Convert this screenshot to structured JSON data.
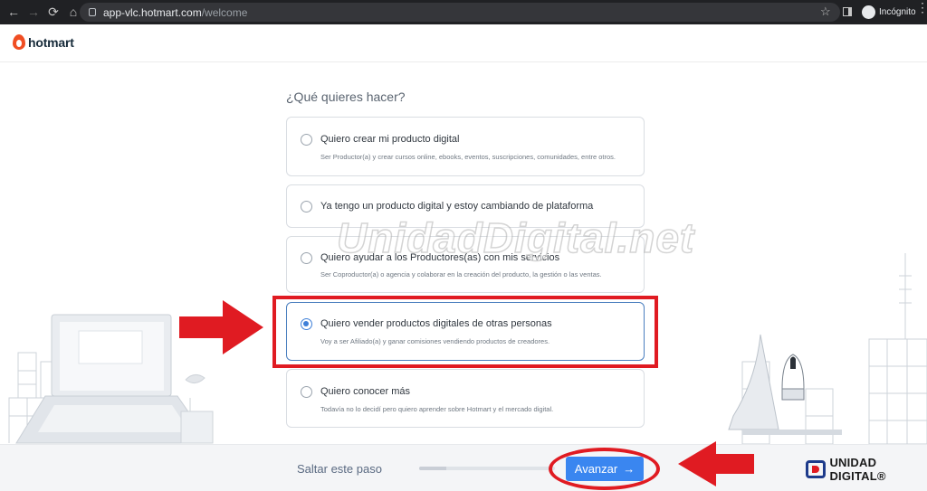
{
  "browser": {
    "url_host": "app-vlc.hotmart.com",
    "url_path": "/welcome",
    "incognito_label": "Incógnito"
  },
  "header": {
    "logo_text": "hotmart"
  },
  "onboarding": {
    "question": "¿Qué quieres hacer?",
    "options": [
      {
        "title": "Quiero crear mi producto digital",
        "description": "Ser Productor(a) y crear cursos online, ebooks, eventos, suscripciones, comunidades, entre otros.",
        "selected": false
      },
      {
        "title": "Ya tengo un producto digital y estoy cambiando de plataforma",
        "description": "",
        "selected": false
      },
      {
        "title": "Quiero ayudar a los Productores(as) con mis servicios",
        "description": "Ser Coproductor(a) o agencia y colaborar en la creación del producto, la gestión o las ventas.",
        "selected": false
      },
      {
        "title": "Quiero vender productos digitales de otras personas",
        "description": "Voy a ser Afiliado(a) y ganar comisiones vendiendo productos de creadores.",
        "selected": true
      },
      {
        "title": "Quiero conocer más",
        "description": "Todavía no lo decidí pero quiero aprender sobre Hotmart y el mercado digital.",
        "selected": false
      }
    ]
  },
  "footer": {
    "skip_label": "Saltar este paso",
    "next_label": "Avanzar",
    "next_arrow": "→",
    "progress": 0.2
  },
  "overlay": {
    "watermark": "UnidadDigital.net",
    "brand": "UNIDAD DIGITAL®",
    "highlight_color": "#e01b22"
  },
  "colors": {
    "accent": "#3a86f0",
    "brand_orange": "#f04e23"
  }
}
